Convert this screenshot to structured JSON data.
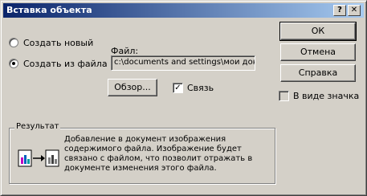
{
  "window": {
    "title": "Вставка объекта",
    "help_button": "?",
    "close_button": "✕"
  },
  "options": {
    "create_new": "Создать новый",
    "create_from_file": "Создать из файла",
    "selected": "create_from_file"
  },
  "file": {
    "label": "Файл:",
    "value": "c:\\documents and settings\\мои докуме"
  },
  "buttons": {
    "browse": "Обзор...",
    "ok": "ОК",
    "cancel": "Отмена",
    "help": "Справка"
  },
  "link": {
    "label": "Связь",
    "checked": true
  },
  "display_as_icon": {
    "label": "В виде значка",
    "checked": false
  },
  "result": {
    "title": "Результат",
    "text": "Добавление в документ изображения содержимого файла.  Изображение будет связано с файлом, что позволит отражать в документе изменения этого файла."
  },
  "icons": {
    "result": "file-link-icon"
  },
  "colors": {
    "title_bar_start": "#0a246a",
    "title_bar_end": "#a6caf0",
    "dialog_face": "#d4d0c8"
  }
}
